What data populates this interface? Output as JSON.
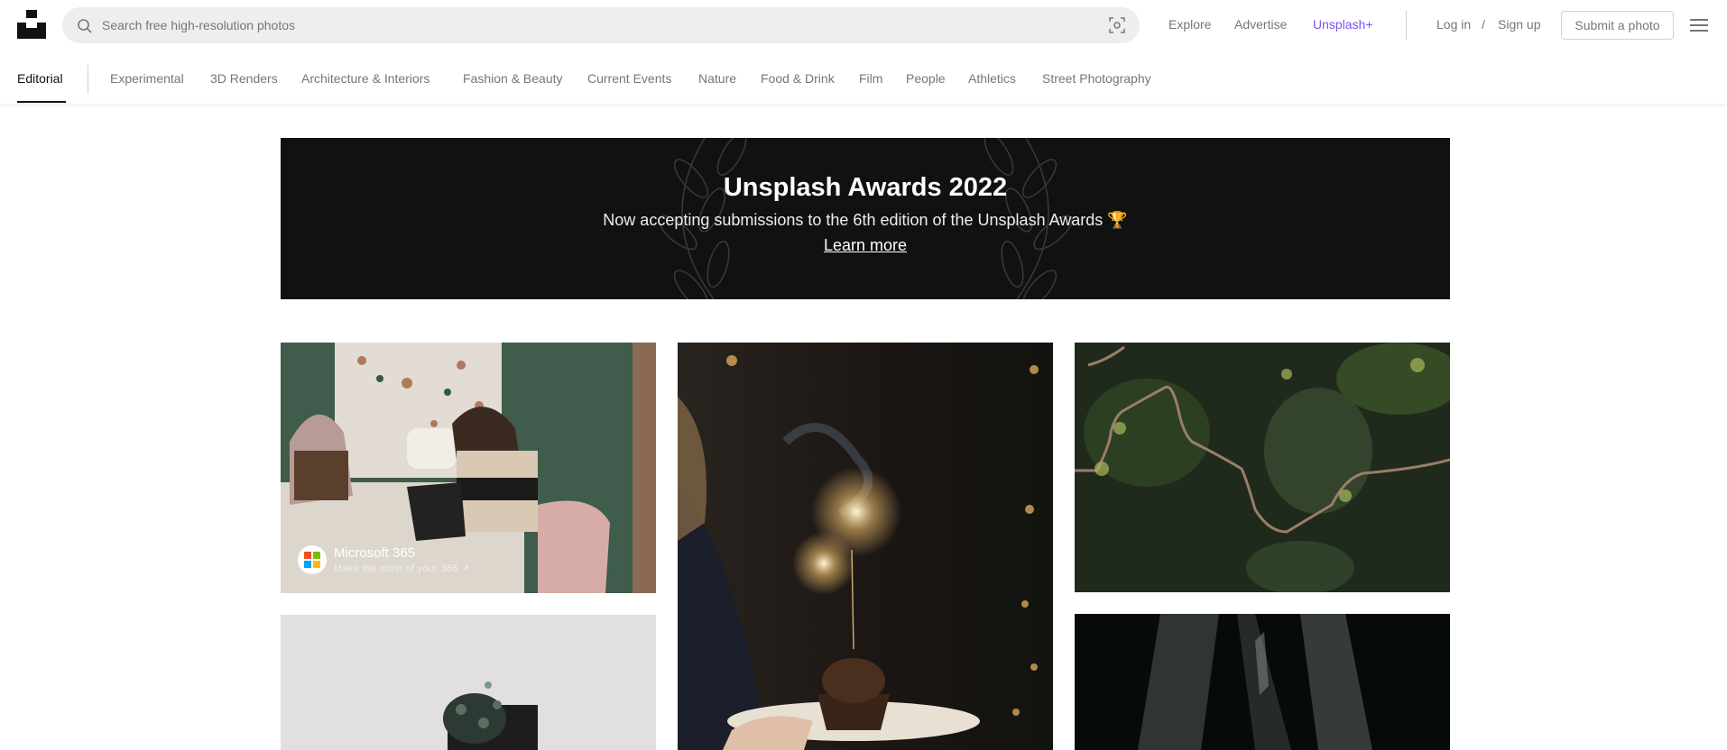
{
  "header": {
    "logo_alt": "Unsplash",
    "search": {
      "placeholder": "Search free high-resolution photos",
      "value": ""
    },
    "nav": {
      "explore": "Explore",
      "advertise": "Advertise",
      "unsplash_plus": "Unsplash+"
    },
    "auth": {
      "login": "Log in",
      "separator": "/",
      "signup": "Sign up"
    },
    "submit_label": "Submit a photo",
    "accent_color": "#7b53ef"
  },
  "categories": {
    "active": "Editorial",
    "items": [
      "Experimental",
      "3D Renders",
      "Architecture & Interiors",
      "Fashion & Beauty",
      "Current Events",
      "Nature",
      "Food & Drink",
      "Film",
      "People",
      "Athletics",
      "Street Photography"
    ]
  },
  "banner": {
    "title": "Unsplash Awards 2022",
    "subtitle": "Now accepting submissions to the 6th edition of the Unsplash Awards 🏆",
    "link": "Learn more"
  },
  "photos": [
    {
      "subject": "Two women working at terrazzo table with laptop",
      "sponsor": {
        "name": "Microsoft 365",
        "tagline": "Make the most of your 365 ↗"
      }
    },
    {
      "subject": "Cupcake with sparkler on a plate"
    },
    {
      "subject": "Aerial view of winding dirt road through forest"
    },
    {
      "subject": "Potted string-of-hearts plant on white background"
    },
    {
      "subject": "Dark abstract metallic shapes"
    }
  ]
}
